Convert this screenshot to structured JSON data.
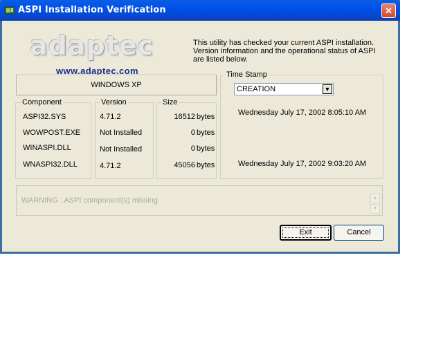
{
  "window": {
    "title": "ASPI Installation Verification",
    "close_glyph": "✕"
  },
  "logo": {
    "wordmark": "adaptec",
    "url": "www.adaptec.com"
  },
  "intro": {
    "text": "This utility has checked your current ASPI installation. Version information and the operational status of ASPI are listed below."
  },
  "os": {
    "name": "WINDOWS XP"
  },
  "groups": {
    "component": {
      "label": "Component"
    },
    "version": {
      "label": "Version"
    },
    "size": {
      "label": "Size"
    },
    "timestamp": {
      "label": "Time Stamp"
    }
  },
  "rows": [
    {
      "component": "ASPI32.SYS",
      "version": "4.71.2",
      "size": "16512",
      "unit": "bytes",
      "timestamp": "Wednesday July 17, 2002 8:05:10 AM"
    },
    {
      "component": "WOWPOST.EXE",
      "version": "Not Installed",
      "size": "0",
      "unit": "bytes",
      "timestamp": ""
    },
    {
      "component": "WINASPI.DLL",
      "version": "Not Installed",
      "size": "0",
      "unit": "bytes",
      "timestamp": ""
    },
    {
      "component": "WNASPI32.DLL",
      "version": "4.71.2",
      "size": "45056",
      "unit": "bytes",
      "timestamp": "Wednesday July 17, 2002 9:03:20 AM"
    }
  ],
  "timestamp_select": {
    "value": "CREATION",
    "arrow_glyph": "▼"
  },
  "warning": {
    "text": "WARNING : ASPI component(s) missing"
  },
  "buttons": {
    "exit": "Exit",
    "cancel": "Cancel"
  },
  "colors": {
    "titlebar": "#0050ee",
    "face": "#ece9d8",
    "close": "#d24a2c",
    "url": "#1b2f8a"
  }
}
